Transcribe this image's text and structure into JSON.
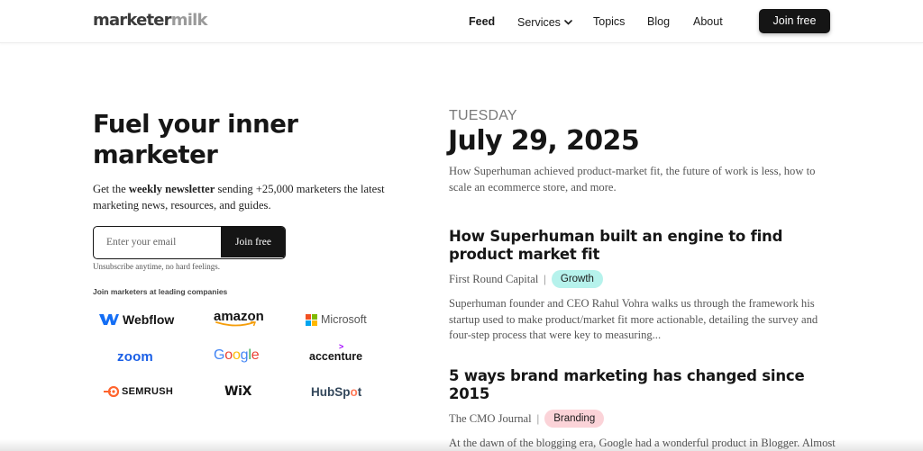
{
  "header": {
    "logo_part1": "marketer",
    "logo_part2": "milk",
    "nav": [
      {
        "label": "Feed",
        "active": true
      },
      {
        "label": "Services",
        "has_dropdown": true
      },
      {
        "label": "Topics"
      },
      {
        "label": "Blog"
      },
      {
        "label": "About"
      }
    ],
    "join_label": "Join free"
  },
  "hero": {
    "title": "Fuel your inner marketer",
    "subtitle_pre": "Get the ",
    "subtitle_bold": "weekly newsletter",
    "subtitle_post": " sending +25,000 marketers the latest marketing news, resources, and guides.",
    "email_placeholder": "Enter your email",
    "join_button": "Join free",
    "unsubscribe_note": "Unsubscribe anytime, no hard feelings.",
    "companies_label": "Join marketers at leading companies",
    "companies": {
      "webflow": "Webflow",
      "amazon": "amazon",
      "microsoft": "Microsoft",
      "zoom": "zoom",
      "google": [
        "G",
        "o",
        "o",
        "g",
        "l",
        "e"
      ],
      "accenture": "accenture",
      "semrush": "SEMRUSH",
      "wix": "WiX",
      "hubspot_a": "HubSp",
      "hubspot_b": "o",
      "hubspot_c": "t"
    }
  },
  "feed": {
    "day": "TUESDAY",
    "date": "July 29, 2025",
    "summary": "How Superhuman achieved product-market fit, the future of work is less, how to scale an ecommerce store, and more.",
    "articles": [
      {
        "title": "How Superhuman built an engine to find product market fit",
        "source": "First Round Capital",
        "tag": "Growth",
        "tag_color": "#b6f2ec",
        "description": "Superhuman founder and CEO Rahul Vohra walks us through the framework his startup used to make product/market fit more actionable, detailing the survey and four-step process that were key to measuring..."
      },
      {
        "title": "5 ways brand marketing has changed since 2015",
        "source": "The CMO Journal",
        "tag": "Branding",
        "tag_color": "#fbd3d8",
        "description": "At the dawn of the blogging era, Google had a wonderful product in Blogger. Almost every internet native who came of age then has used it. It was simple,"
      }
    ]
  },
  "colors": {
    "dark_button": "#151515",
    "growth_tag": "#b6f2ec",
    "branding_tag": "#fbd3d8"
  }
}
